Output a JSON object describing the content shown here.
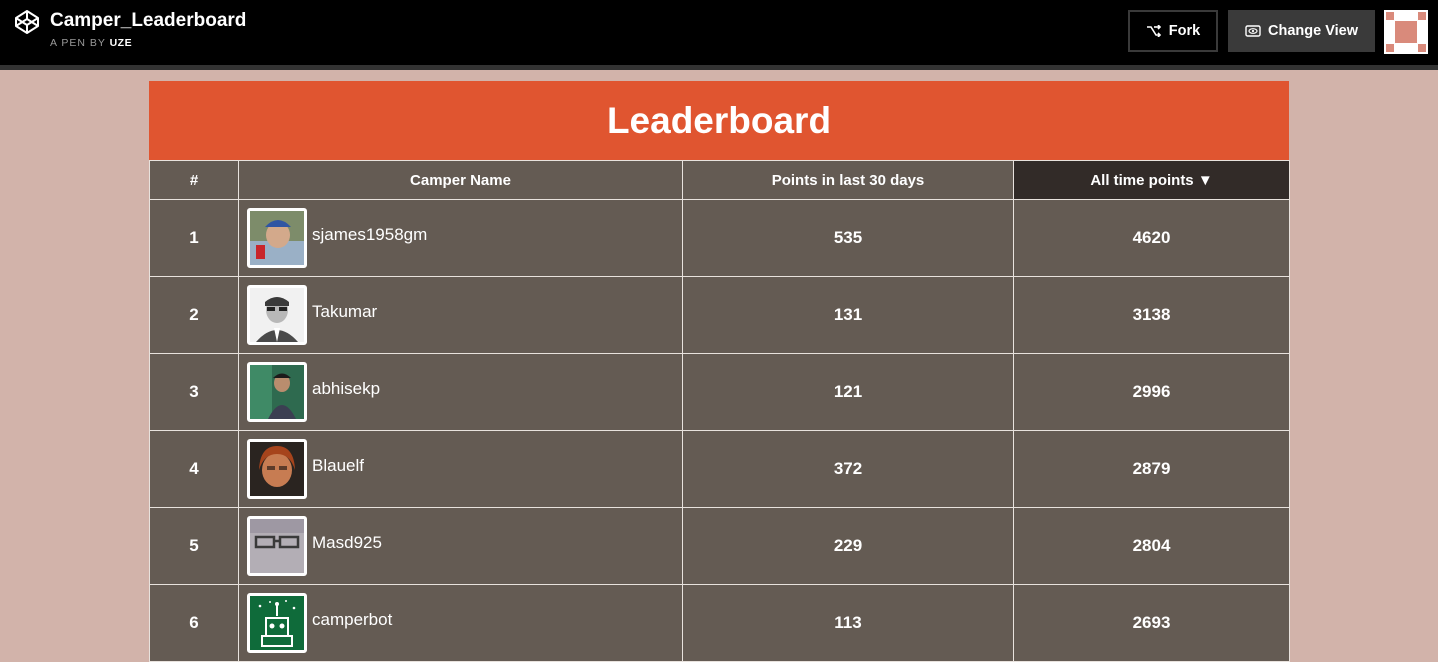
{
  "topbar": {
    "title": "Camper_Leaderboard",
    "byline_prefix": "A PEN BY",
    "author": "UZE",
    "fork_label": "Fork",
    "change_view_label": "Change View"
  },
  "board": {
    "heading": "Leaderboard",
    "columns": {
      "rank": "#",
      "name": "Camper Name",
      "recent": "Points in last 30 days",
      "alltime": "All time points ▼"
    },
    "rows": [
      {
        "rank": "1",
        "name": "sjames1958gm",
        "recent": "535",
        "alltime": "4620"
      },
      {
        "rank": "2",
        "name": "Takumar",
        "recent": "131",
        "alltime": "3138"
      },
      {
        "rank": "3",
        "name": "abhisekp",
        "recent": "121",
        "alltime": "2996"
      },
      {
        "rank": "4",
        "name": "Blauelf",
        "recent": "372",
        "alltime": "2879"
      },
      {
        "rank": "5",
        "name": "Masd925",
        "recent": "229",
        "alltime": "2804"
      },
      {
        "rank": "6",
        "name": "camperbot",
        "recent": "113",
        "alltime": "2693"
      }
    ]
  },
  "colors": {
    "page_bg": "#d2b3aa",
    "header_accent": "#e05530",
    "table_bg": "#645b53",
    "sorted_header_bg": "#322b28"
  },
  "icons": {
    "logo": "codepen-logo-icon",
    "fork": "fork-icon",
    "change_view": "eye-icon",
    "user_avatar": "user-avatar"
  }
}
